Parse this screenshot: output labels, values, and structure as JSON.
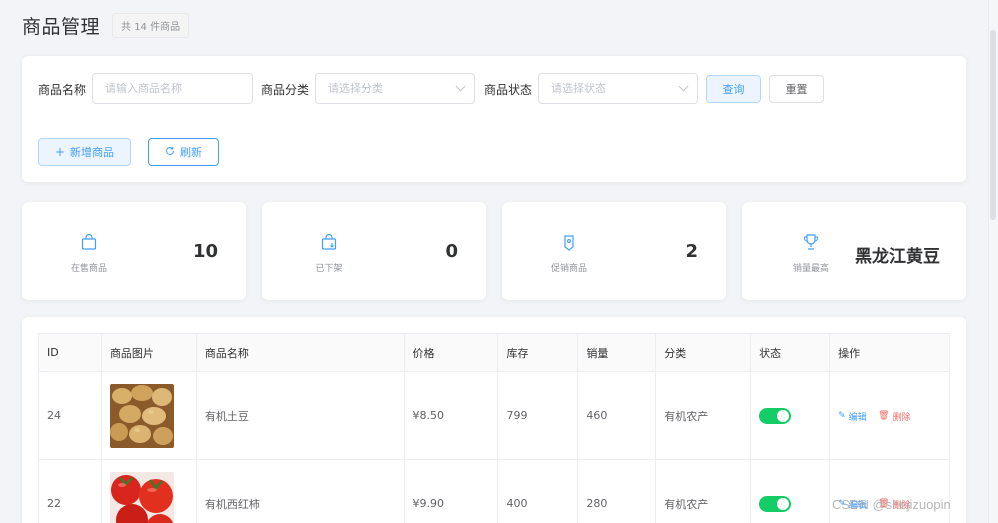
{
  "header": {
    "title": "商品管理",
    "count_badge": "共 14 件商品"
  },
  "search": {
    "name_label": "商品名称",
    "name_placeholder": "请输入商品名称",
    "category_label": "商品分类",
    "category_placeholder": "请选择分类",
    "status_label": "商品状态",
    "status_placeholder": "请选择状态",
    "query_button": "查询",
    "reset_button": "重置",
    "add_button": "新增商品",
    "refresh_button": "刷新"
  },
  "stats": [
    {
      "label": "在售商品",
      "value": "10",
      "icon": "shopping-bag-icon"
    },
    {
      "label": "已下架",
      "value": "0",
      "icon": "bag-down-icon"
    },
    {
      "label": "促销商品",
      "value": "2",
      "icon": "price-tag-icon"
    },
    {
      "label": "销量最高",
      "value": "黑龙江黄豆",
      "icon": "trophy-icon"
    }
  ],
  "table": {
    "headers": [
      "ID",
      "商品图片",
      "商品名称",
      "价格",
      "库存",
      "销量",
      "分类",
      "状态",
      "操作"
    ],
    "rows": [
      {
        "id": "24",
        "image": "potatoes-photo",
        "name": "有机土豆",
        "price": "¥8.50",
        "stock": "799",
        "sales": "460",
        "category": "有机农产",
        "status_on": true,
        "edit": "编辑",
        "delete": "删除"
      },
      {
        "id": "22",
        "image": "tomatoes-photo",
        "name": "有机西红柿",
        "price": "¥9.90",
        "stock": "400",
        "sales": "280",
        "category": "有机农产",
        "status_on": true,
        "edit": "编辑",
        "delete": "删除"
      }
    ]
  },
  "watermark": "CSDN @shejizuopin",
  "colors": {
    "primary": "#409eff",
    "success": "#13ce66",
    "danger": "#f56c6c",
    "background": "#f2f4f7"
  }
}
